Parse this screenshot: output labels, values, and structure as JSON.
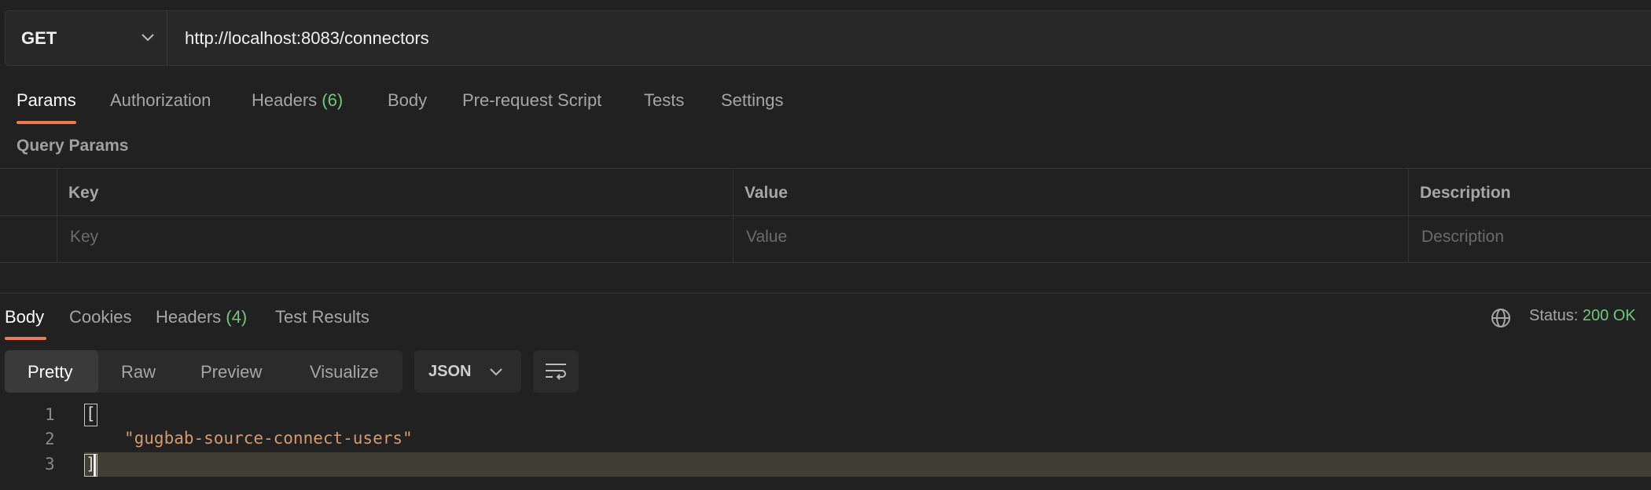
{
  "request": {
    "method": "GET",
    "url": "http://localhost:8083/connectors"
  },
  "request_tabs": [
    {
      "label": "Params"
    },
    {
      "label": "Authorization"
    },
    {
      "label": "Headers",
      "count": "(6)"
    },
    {
      "label": "Body"
    },
    {
      "label": "Pre-request Script"
    },
    {
      "label": "Tests"
    },
    {
      "label": "Settings"
    }
  ],
  "query_params": {
    "title": "Query Params",
    "columns": [
      "Key",
      "Value",
      "Description"
    ],
    "placeholders": [
      "Key",
      "Value",
      "Description"
    ]
  },
  "response_tabs": [
    {
      "label": "Body"
    },
    {
      "label": "Cookies"
    },
    {
      "label": "Headers",
      "count": "(4)"
    },
    {
      "label": "Test Results"
    }
  ],
  "status": {
    "label": "Status:",
    "value": "200 OK"
  },
  "view_modes": [
    "Pretty",
    "Raw",
    "Preview",
    "Visualize"
  ],
  "format": "JSON",
  "code": {
    "line_numbers": [
      "1",
      "2",
      "3"
    ],
    "open_bracket": "[",
    "string_value": "\"gugbab-source-connect-users\"",
    "close_bracket": "]"
  },
  "colors": {
    "accent": "#ee7a53",
    "success": "#6fc97a",
    "string": "#d39a72",
    "background": "#212121"
  },
  "icons": [
    "chevron-down-icon",
    "globe-icon",
    "wrap-lines-icon"
  ]
}
